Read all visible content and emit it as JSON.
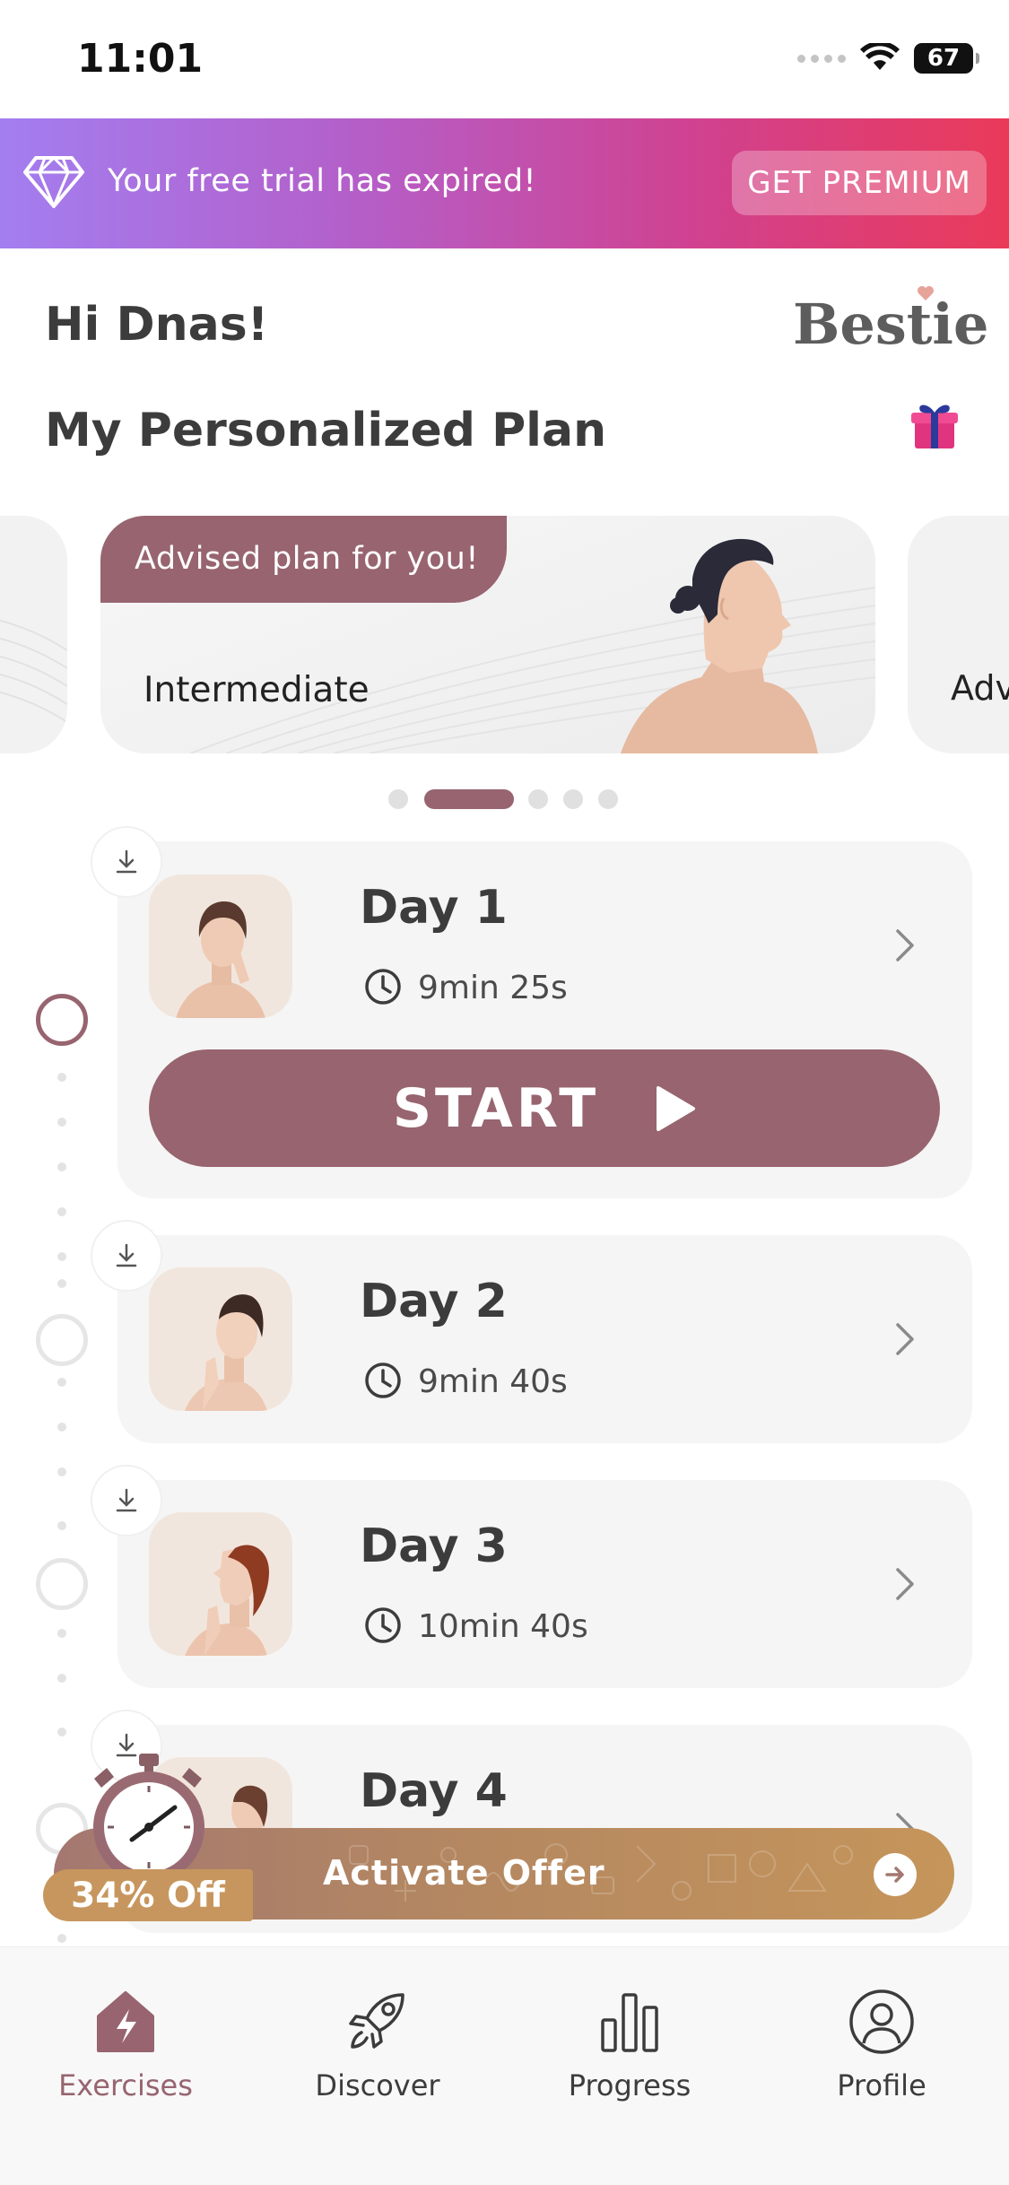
{
  "status_bar": {
    "time": "11:01",
    "battery": "67"
  },
  "banner": {
    "message": "Your free trial has expired!",
    "cta": "GET PREMIUM"
  },
  "header": {
    "greeting": "Hi Dnas!",
    "brand": "Bestie",
    "plan_title": "My Personalized Plan"
  },
  "carousel": {
    "tag": "Advised plan for you!",
    "current_level": "Intermediate",
    "next_level": "Adv",
    "page_count": 5,
    "active_index": 1
  },
  "start_label": "START",
  "days": [
    {
      "title": "Day 1",
      "duration": "9min 25s"
    },
    {
      "title": "Day 2",
      "duration": "9min 40s"
    },
    {
      "title": "Day 3",
      "duration": "10min 40s"
    },
    {
      "title": "Day 4",
      "duration": ""
    }
  ],
  "offer": {
    "discount": "34% Off",
    "label": "Activate Offer"
  },
  "tabs": [
    {
      "label": "Exercises",
      "icon": "exercises-house-icon",
      "active": true
    },
    {
      "label": "Discover",
      "icon": "rocket-icon",
      "active": false
    },
    {
      "label": "Progress",
      "icon": "bar-chart-icon",
      "active": false
    },
    {
      "label": "Profile",
      "icon": "profile-icon",
      "active": false
    }
  ],
  "colors": {
    "accent": "#97646f",
    "banner_start": "#a37ef0",
    "banner_end": "#ea3a59",
    "offer": "#c7965e"
  }
}
